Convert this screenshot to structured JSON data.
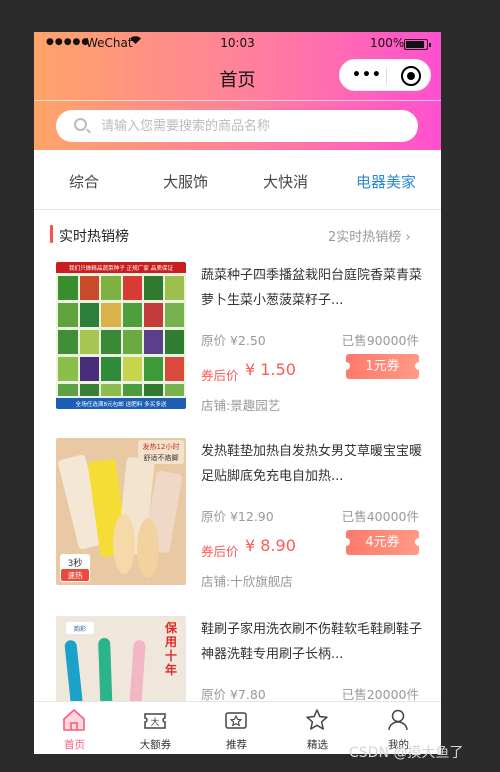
{
  "status_bar": {
    "signal": "●●●●●",
    "carrier": "WeChat",
    "time": "10:03",
    "battery": "100%"
  },
  "nav": {
    "title": "首页"
  },
  "search": {
    "placeholder": "请输入您需要搜索的商品名称"
  },
  "tabs": [
    {
      "label": "综合",
      "active": false
    },
    {
      "label": "大服饰",
      "active": false
    },
    {
      "label": "大快消",
      "active": false
    },
    {
      "label": "电器美家",
      "active": true
    }
  ],
  "section": {
    "title": "实时热销榜",
    "more": "2实时热销榜 ›"
  },
  "products": [
    {
      "name": "蔬菜种子四季播盆栽阳台庭院香菜青菜萝卜生菜小葱菠菜籽子...",
      "orig_price": "原价 ¥2.50",
      "sold": "已售90000件",
      "after_label": "券后价",
      "after_price": "¥ 1.50",
      "coupon": "1元券",
      "shop": "店铺:景趣园艺",
      "image_text": {
        "banner": "我们只做精品蔬菜种子 正规厂家 品质保证",
        "footer": "全场任选满8元包邮 送肥料 多买多送"
      }
    },
    {
      "name": "发热鞋垫加热自发热女男艾草暖宝宝暖足贴脚底免充电自加热...",
      "orig_price": "原价 ¥12.90",
      "sold": "已售40000件",
      "after_label": "券后价",
      "after_price": "¥ 8.90",
      "coupon": "4元券",
      "shop": "店铺:十欣旗舰店",
      "image_text": {
        "top1": "发热12小时",
        "top2": "舒适不烙脚",
        "bottom1": "3秒",
        "bottom2": "速热"
      }
    },
    {
      "name": "鞋刷子家用洗衣刷不伤鞋软毛鞋刷鞋子神器洗鞋专用刷子长柄...",
      "orig_price": "原价 ¥7.80",
      "sold": "已售20000件",
      "after_label": "",
      "after_price": "",
      "coupon": "",
      "shop": "",
      "image_text": {
        "right": "保用十年",
        "logo": "韵彩"
      }
    }
  ],
  "tabbar": [
    {
      "label": "首页",
      "icon": "home-icon",
      "active": true
    },
    {
      "label": "大额券",
      "icon": "coupon-icon",
      "active": false
    },
    {
      "label": "推荐",
      "icon": "recommend-icon",
      "active": false
    },
    {
      "label": "精选",
      "icon": "star-icon",
      "active": false
    },
    {
      "label": "我的",
      "icon": "user-icon",
      "active": false
    }
  ],
  "watermark": "CSDN @摸大鱼了",
  "colors": {
    "accent": "#ff5a5a",
    "active_tab": "#2a8ad6",
    "tabbar_active": "#ff5a7a"
  }
}
